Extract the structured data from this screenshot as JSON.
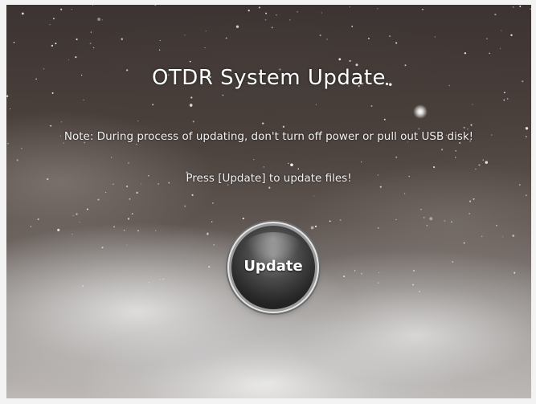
{
  "screen": {
    "title": "OTDR System Update",
    "note": "Note: During process of updating, don't turn off power or pull out USB disk!",
    "hint": "Press [Update] to update files!"
  },
  "update_button": {
    "label": "Update"
  },
  "colors": {
    "text": "#ffffff",
    "background_dark": "#3c3432",
    "background_light": "#bdb8b5"
  }
}
